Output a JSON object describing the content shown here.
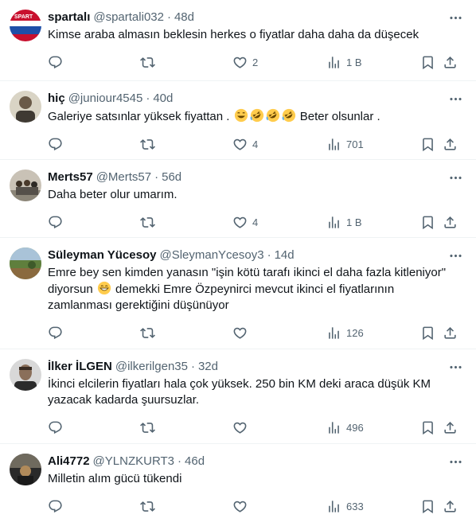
{
  "tweets": [
    {
      "name": "spartalı",
      "handle": "@spartali032",
      "time": "48d",
      "text": "Kimse araba almasın beklesin herkes o fiyatlar daha daha da düşecek",
      "replies": "",
      "retweets": "",
      "likes": "2",
      "views": "1 B",
      "avatar": "spartali-flag-avatar"
    },
    {
      "name": "hiç",
      "handle": "@juniour4545",
      "time": "40d",
      "text_before": "Galeriye satsınlar yüksek fiyattan .",
      "emojis": [
        "grinning-sweat-emoji",
        "rolling-laughing-emoji",
        "rolling-laughing-emoji",
        "rolling-laughing-emoji"
      ],
      "text_after": "Beter olsunlar .",
      "replies": "",
      "retweets": "",
      "likes": "4",
      "views": "701",
      "avatar": "portrait-avatar"
    },
    {
      "name": "Merts57",
      "handle": "@Merts57",
      "time": "56d",
      "text": "Daha beter olur umarım.",
      "replies": "",
      "retweets": "",
      "likes": "4",
      "views": "1 B",
      "avatar": "group-photo-avatar"
    },
    {
      "name": "Süleyman Yücesoy",
      "handle": "@SleymanYcesoy3",
      "time": "14d",
      "text_before": "Emre bey sen kimden yanasın \"işin kötü tarafı ikinci el daha fazla kitleniyor\" diyorsun",
      "emojis": [
        "grinning-emoji"
      ],
      "text_after": "demekki Emre Özpeynirci mevcut ikinci el fiyatlarının zamlanması gerektiğini düşünüyor",
      "replies": "",
      "retweets": "",
      "likes": "",
      "views": "126",
      "avatar": "landscape-avatar"
    },
    {
      "name": "İlker İLGEN",
      "handle": "@ilkerilgen35",
      "time": "32d",
      "text": "İkinci elcilerin fiyatları hala çok yüksek. 250 bin KM deki araca düşük KM yazacak kadarda şuursuzlar.",
      "replies": "",
      "retweets": "",
      "likes": "",
      "views": "496",
      "avatar": "man-portrait-avatar"
    },
    {
      "name": "Ali4772",
      "handle": "@YLNZKURT3",
      "time": "46d",
      "text": "Milletin alım gücü tükendi",
      "replies": "",
      "retweets": "",
      "likes": "",
      "views": "633",
      "avatar": "dark-photo-avatar"
    }
  ],
  "colors": {
    "text": "#0f1419",
    "secondary": "#536471",
    "divider": "#eff3f4"
  }
}
